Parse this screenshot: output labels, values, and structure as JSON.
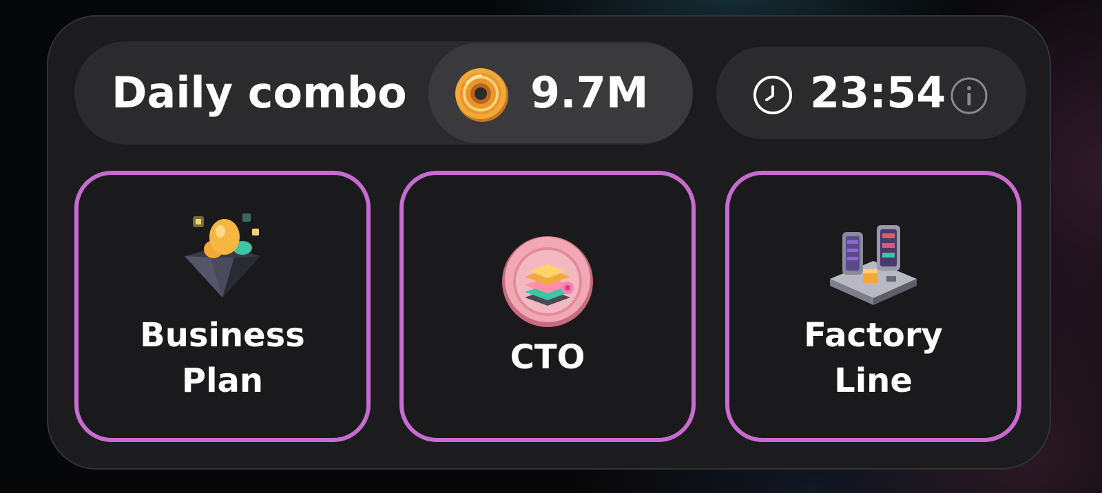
{
  "header": {
    "title": "Daily combo",
    "reward": "9.7M",
    "reward_icon": "coin-icon",
    "timer": "23:54",
    "timer_icon": "clock-icon",
    "info_icon": "info-icon"
  },
  "slots": [
    {
      "line1": "Business",
      "line2": "Plan",
      "icon": "business-plan-icon"
    },
    {
      "line1": "CTO",
      "line2": "",
      "icon": "cto-icon"
    },
    {
      "line1": "Factory",
      "line2": "Line",
      "icon": "factory-line-icon"
    }
  ],
  "colors": {
    "card_bg": "#1c1c1e",
    "pill_bg": "#2b2b2e",
    "reward_pill_bg": "#3a3a3d",
    "slot_border": "#c86bd0",
    "text": "#ffffff",
    "coin": "#f2a93b"
  }
}
